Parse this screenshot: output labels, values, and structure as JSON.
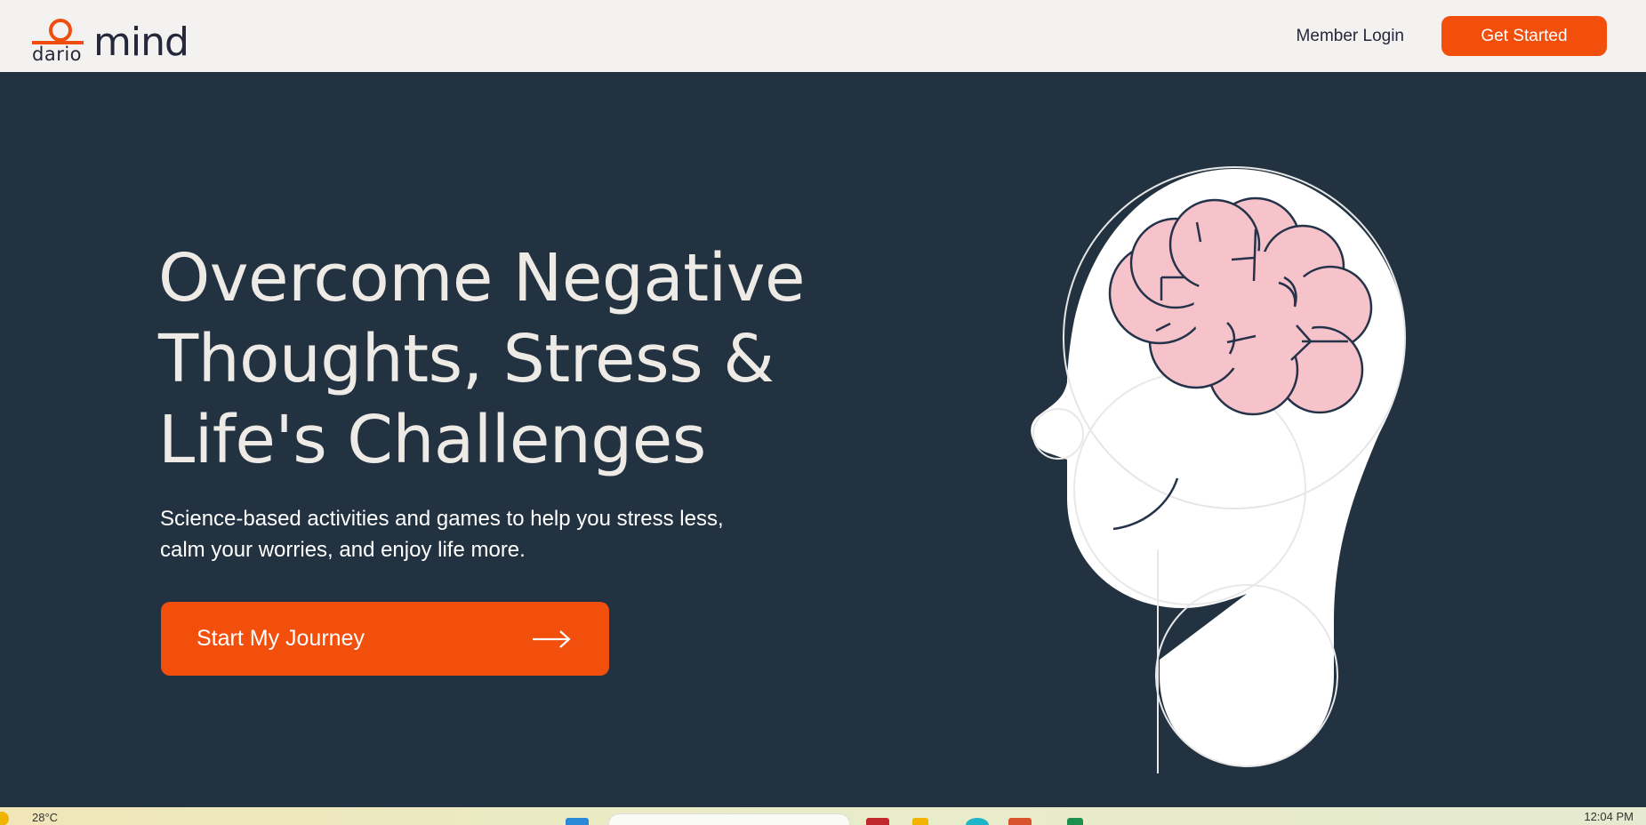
{
  "header": {
    "logo": {
      "small": "dario",
      "large": "mind"
    },
    "member_login": "Member Login",
    "get_started": "Get Started"
  },
  "hero": {
    "title_lines": [
      "Overcome Negative",
      "Thoughts, Stress &",
      "Life's Challenges"
    ],
    "subtitle_lines": [
      "Science-based activities and games to help you stress less,",
      "calm your worries, and enjoy life more."
    ],
    "cta_label": "Start My Journey"
  },
  "taskbar": {
    "weather": "28°C",
    "time": "12:04 PM"
  },
  "colors": {
    "header_bg": "#f4f2f0",
    "hero_bg": "#223240",
    "accent": "#f24e0c",
    "brain": "#f7c3ca",
    "head": "#ffffff"
  },
  "icons": [
    "arrow-right-icon",
    "head-brain-illustration",
    "windows-start-icon",
    "weather-icon"
  ]
}
